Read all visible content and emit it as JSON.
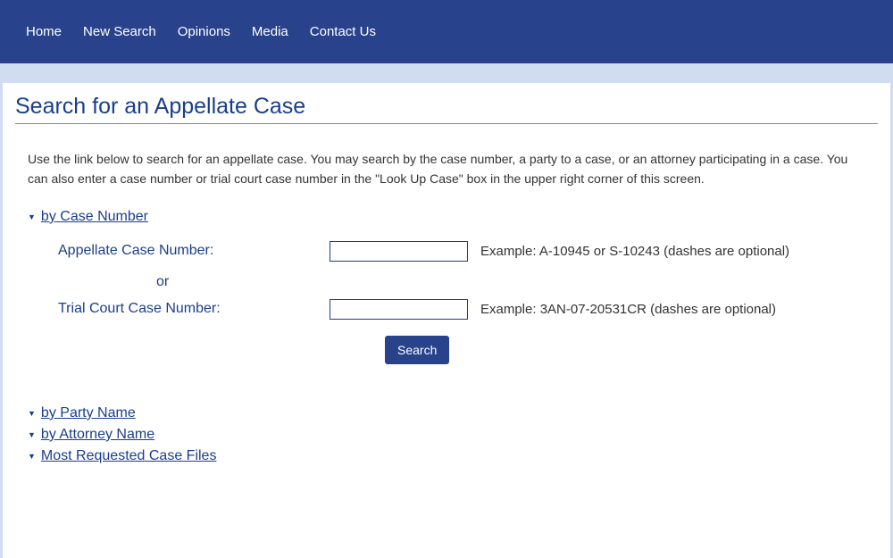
{
  "nav": {
    "items": [
      "Home",
      "New Search",
      "Opinions",
      "Media",
      "Contact Us"
    ]
  },
  "page": {
    "title": "Search for an Appellate Case",
    "intro": "Use the link below to search for an appellate case. You may search by the case number, a party to a case, or an attorney participating in a case. You can also enter a case number or trial court case number in the \"Look Up Case\" box in the upper right corner of this screen."
  },
  "sections": {
    "case_number": {
      "label": "by Case Number",
      "appellate_label": "Appellate Case Number:",
      "or_label": "or",
      "trial_label": "Trial Court Case Number:",
      "appellate_example": "Example: A-10945 or S-10243 (dashes are optional)",
      "trial_example": "Example: 3AN-07-20531CR (dashes are optional)",
      "search_button": "Search"
    },
    "party_name": {
      "label": "by Party Name"
    },
    "attorney_name": {
      "label": "by Attorney Name"
    },
    "most_requested": {
      "label": "Most Requested Case Files"
    }
  }
}
